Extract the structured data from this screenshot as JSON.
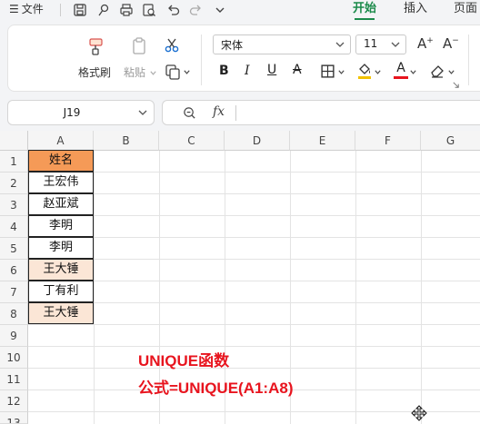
{
  "titlebar": {
    "menu_label": "文件",
    "tabs": [
      {
        "label": "开始",
        "active": true
      },
      {
        "label": "插入",
        "active": false
      },
      {
        "label": "页面",
        "active": false
      }
    ]
  },
  "ribbon": {
    "format_painter": "格式刷",
    "paste": "粘贴",
    "font_name": "宋体",
    "font_size": "11"
  },
  "formula_bar": {
    "name_box": "J19",
    "fx_label": "fx",
    "formula": ""
  },
  "sheet": {
    "columns": [
      "A",
      "B",
      "C",
      "D",
      "E",
      "F",
      "G"
    ],
    "rows": [
      "1",
      "2",
      "3",
      "4",
      "5",
      "6",
      "7",
      "8",
      "9",
      "10",
      "11",
      "12",
      "13"
    ],
    "column_a": [
      "姓名",
      "王宏伟",
      "赵亚斌",
      "李明",
      "李明",
      "王大锤",
      "丁有利",
      "王大锤"
    ],
    "header_fill": "#f59a57",
    "duplicate_fill": "#fbe6d6",
    "note_title": "UNIQUE函数",
    "note_formula": "公式=UNIQUE(A1:A8)",
    "note_color": "#e8141e"
  }
}
